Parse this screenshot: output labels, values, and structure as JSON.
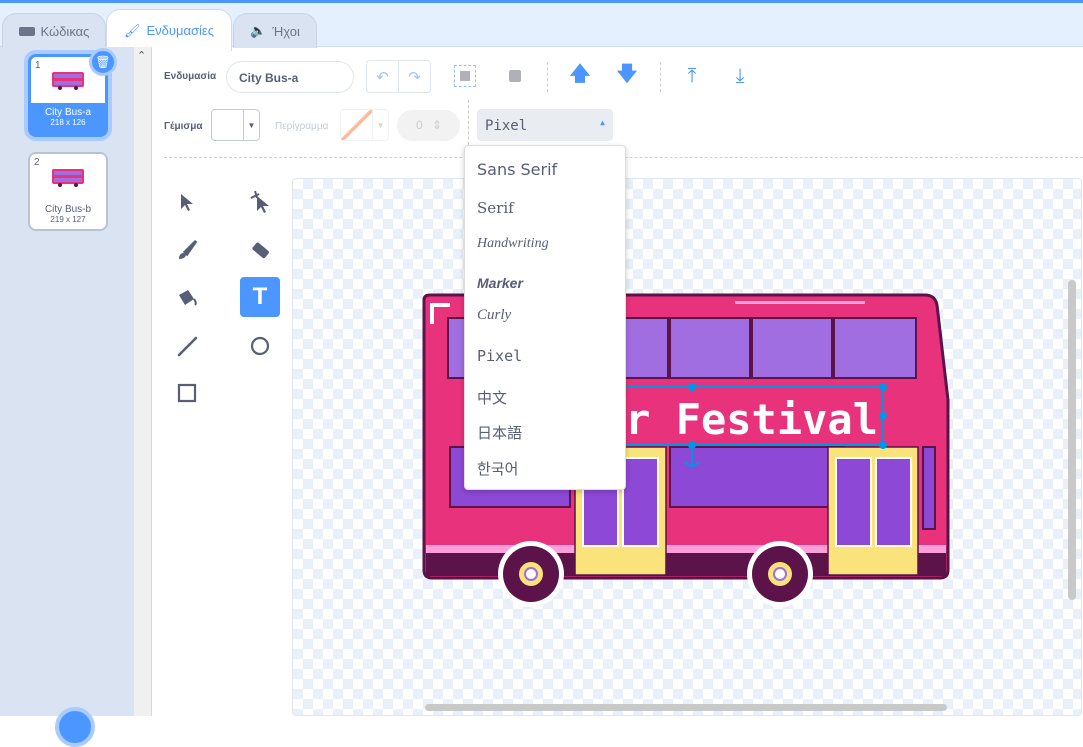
{
  "tabs": [
    {
      "label": "Κώδικας"
    },
    {
      "label": "Ενδυμασίες"
    },
    {
      "label": "Ήχοι"
    }
  ],
  "costumes": [
    {
      "number": "1",
      "name": "City Bus-a",
      "size": "218 x 126",
      "selected": true
    },
    {
      "number": "2",
      "name": "City Bus-b",
      "size": "219 x 127",
      "selected": false
    }
  ],
  "toolbar": {
    "costume_label": "Ενδυμασία",
    "costume_name": "City Bus-a",
    "fill_label": "Γέμισμα",
    "outline_label": "Περίγραμμα",
    "outline_width": "0",
    "font_selected": "Pixel"
  },
  "font_menu": [
    "Sans Serif",
    "Serif",
    "Handwriting",
    "Marker",
    "Curly",
    "Pixel",
    "中文",
    "日本語",
    "한국어"
  ],
  "canvas": {
    "text_object": "r Festival"
  },
  "colors": {
    "accent": "#4c97ff",
    "bus_pink": "#e8327c",
    "bus_dark": "#5c1349",
    "window": "#a06ee0",
    "door": "#fbe37b"
  }
}
